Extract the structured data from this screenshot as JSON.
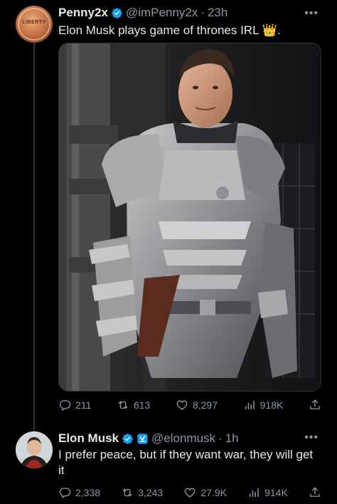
{
  "tweets": [
    {
      "name": "Penny2x",
      "handle": "@imPenny2x",
      "sep": "·",
      "time": "23h",
      "text": "Elon Musk plays game of thrones IRL",
      "text_emoji": "👑",
      "text_suffix": ".",
      "avatar_label": "LIBERTY",
      "actions": {
        "replies": "211",
        "retweets": "613",
        "likes": "8,297",
        "views": "918K"
      }
    },
    {
      "name": "Elon Musk",
      "handle": "@elonmusk",
      "sep": "·",
      "time": "1h",
      "text": "I prefer peace, but if they want war, they will get it",
      "actions": {
        "replies": "2,338",
        "retweets": "3,243",
        "likes": "27.9K",
        "views": "914K"
      }
    }
  ],
  "icons": {
    "reply": "reply-icon",
    "retweet": "retweet-icon",
    "like": "heart-icon",
    "views": "views-icon",
    "share": "share-icon",
    "verified": "verified-badge-icon",
    "government": "government-badge-icon",
    "more": "more-icon"
  },
  "colors": {
    "background": "#000000",
    "text": "#e7e9ea",
    "muted": "#8b98a5",
    "verified_blue": "#1d9bf0",
    "thread_line": "#333639"
  }
}
